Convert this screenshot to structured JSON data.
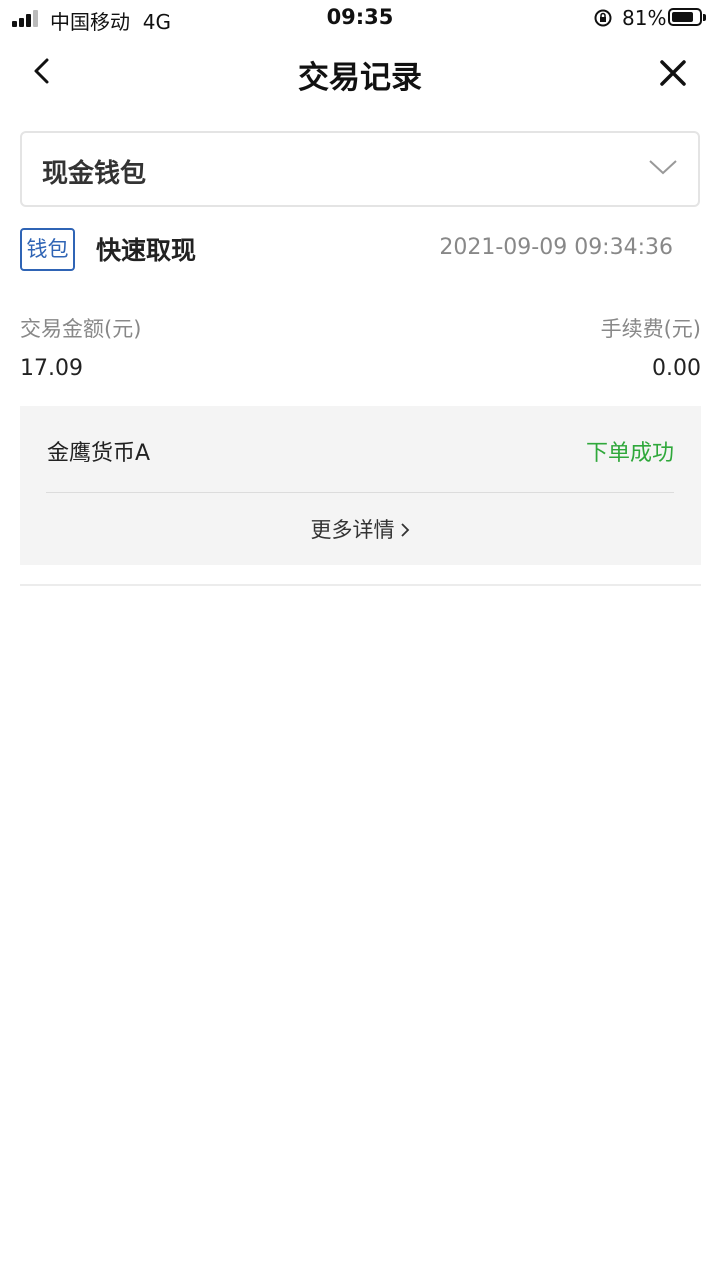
{
  "status_bar": {
    "carrier": "中国移动",
    "network": "4G",
    "time": "09:35",
    "battery_percent": "81%",
    "battery_level": 0.81
  },
  "nav": {
    "title": "交易记录",
    "back_icon": "chevron-left-icon",
    "close_icon": "close-icon"
  },
  "wallet_selector": {
    "selected": "现金钱包",
    "icon": "chevron-down-icon"
  },
  "transaction": {
    "tag": "钱包",
    "type": "快速取现",
    "datetime": "2021-09-09 09:34:36",
    "amount_label": "交易金额(元)",
    "amount": "17.09",
    "fee_label": "手续费(元)",
    "fee": "0.00",
    "fund_name": "金鹰货币A",
    "status": "下单成功",
    "more_details": "更多详情"
  },
  "colors": {
    "tag_blue": "#2f64b5",
    "success_green": "#2fa83b",
    "card_bg": "#f4f4f4"
  }
}
